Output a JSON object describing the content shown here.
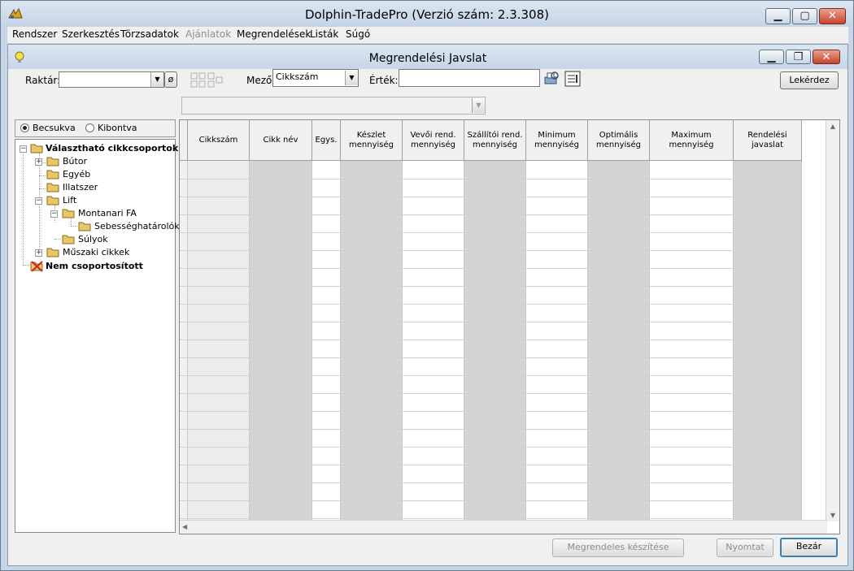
{
  "window": {
    "title": "Dolphin-TradePro  (Verzió szám: 2.3.308)",
    "minimize_glyph": "▁",
    "maximize_glyph": "▢",
    "close_glyph": "✕"
  },
  "menu": {
    "items": [
      {
        "label": "Rendszer",
        "enabled": true
      },
      {
        "label": "Szerkesztés",
        "enabled": true
      },
      {
        "label": "Törzsadatok",
        "enabled": true
      },
      {
        "label": "Ajánlatok",
        "enabled": false
      },
      {
        "label": "Megrendelések",
        "enabled": true
      },
      {
        "label": "Listák",
        "enabled": true
      },
      {
        "label": "Súgó",
        "enabled": true
      }
    ]
  },
  "child": {
    "title": "Megrendelési Javslat",
    "minimize_glyph": "▁",
    "restore_glyph": "❐",
    "close_glyph": "✕"
  },
  "filters": {
    "raktar_label": "Raktár:",
    "raktar_value": "",
    "raktar_clear": "ø",
    "mezo_label": "Mező:",
    "mezo_value": "Cikkszám",
    "ertek_label": "Érték:",
    "ertek_value": "",
    "query_button": "Lekérdez"
  },
  "tree_toggle": {
    "collapsed_label": "Becsukva",
    "expanded_label": "Kibontva",
    "selected": "collapsed"
  },
  "tree": {
    "root": "Választható cikkcsoportok:",
    "nodes": [
      {
        "label": "Bútor"
      },
      {
        "label": "Egyéb"
      },
      {
        "label": "Illatszer"
      },
      {
        "label": "Lift"
      },
      {
        "label": "Montanari FA"
      },
      {
        "label": "Sebességhatárolók"
      },
      {
        "label": "Súlyok"
      },
      {
        "label": "Műszaki cikkek"
      }
    ],
    "ungrouped": "Nem csoportosított"
  },
  "grid": {
    "columns": [
      {
        "label": "",
        "shade": "gray"
      },
      {
        "label": "Cikkszám",
        "shade": "light"
      },
      {
        "label": "Cikk név",
        "shade": "dark"
      },
      {
        "label": "Egys.",
        "shade": "white"
      },
      {
        "label": "Készlet mennyiség",
        "shade": "dark"
      },
      {
        "label": "Vevői rend. mennyiség",
        "shade": "white"
      },
      {
        "label": "Szállítói rend. mennyiség",
        "shade": "dark"
      },
      {
        "label": "Minimum mennyiség",
        "shade": "white"
      },
      {
        "label": "Optimális mennyiség",
        "shade": "dark"
      },
      {
        "label": "Maximum mennyiség",
        "shade": "white"
      },
      {
        "label": "Rendelési javaslat",
        "shade": "dark"
      }
    ],
    "row_count": 20
  },
  "footer": {
    "create_order": "Megrendeles készítése",
    "print": "Nyomtat",
    "close": "Bezár"
  },
  "colors": {
    "shade_dark": "#d4d4d4",
    "shade_light": "#ececec",
    "shade_gray": "#f0f0f0",
    "shade_white": "#ffffff",
    "folder": "#e8c66a"
  }
}
